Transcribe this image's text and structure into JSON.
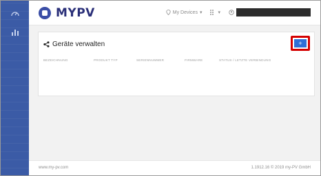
{
  "brand": {
    "logo_text": "MYPV"
  },
  "sidebar": {
    "items": [
      {
        "icon": "gauge-icon"
      },
      {
        "icon": "bar-chart-icon"
      }
    ]
  },
  "header": {
    "devices_label": "My Devices",
    "grid_menu_label": "",
    "user_name_redacted": ""
  },
  "card": {
    "title": "Geräte verwalten",
    "add_button_label": "+",
    "columns": [
      "BEZEICHNUNG",
      "PRODUKT TYP",
      "SERIENNUMMER",
      "FIRMWARE",
      "STATUS / LETZTE VERBINDUNG"
    ]
  },
  "footer": {
    "left_text": "www.my-pv.com",
    "right_text": "1.1912.16 © 2019 my-PV GmbH"
  },
  "colors": {
    "sidebar": "#3b5ba6",
    "accent_button": "#2f6fd8",
    "highlight_box": "#d40000",
    "brand": "#2a2f78"
  }
}
